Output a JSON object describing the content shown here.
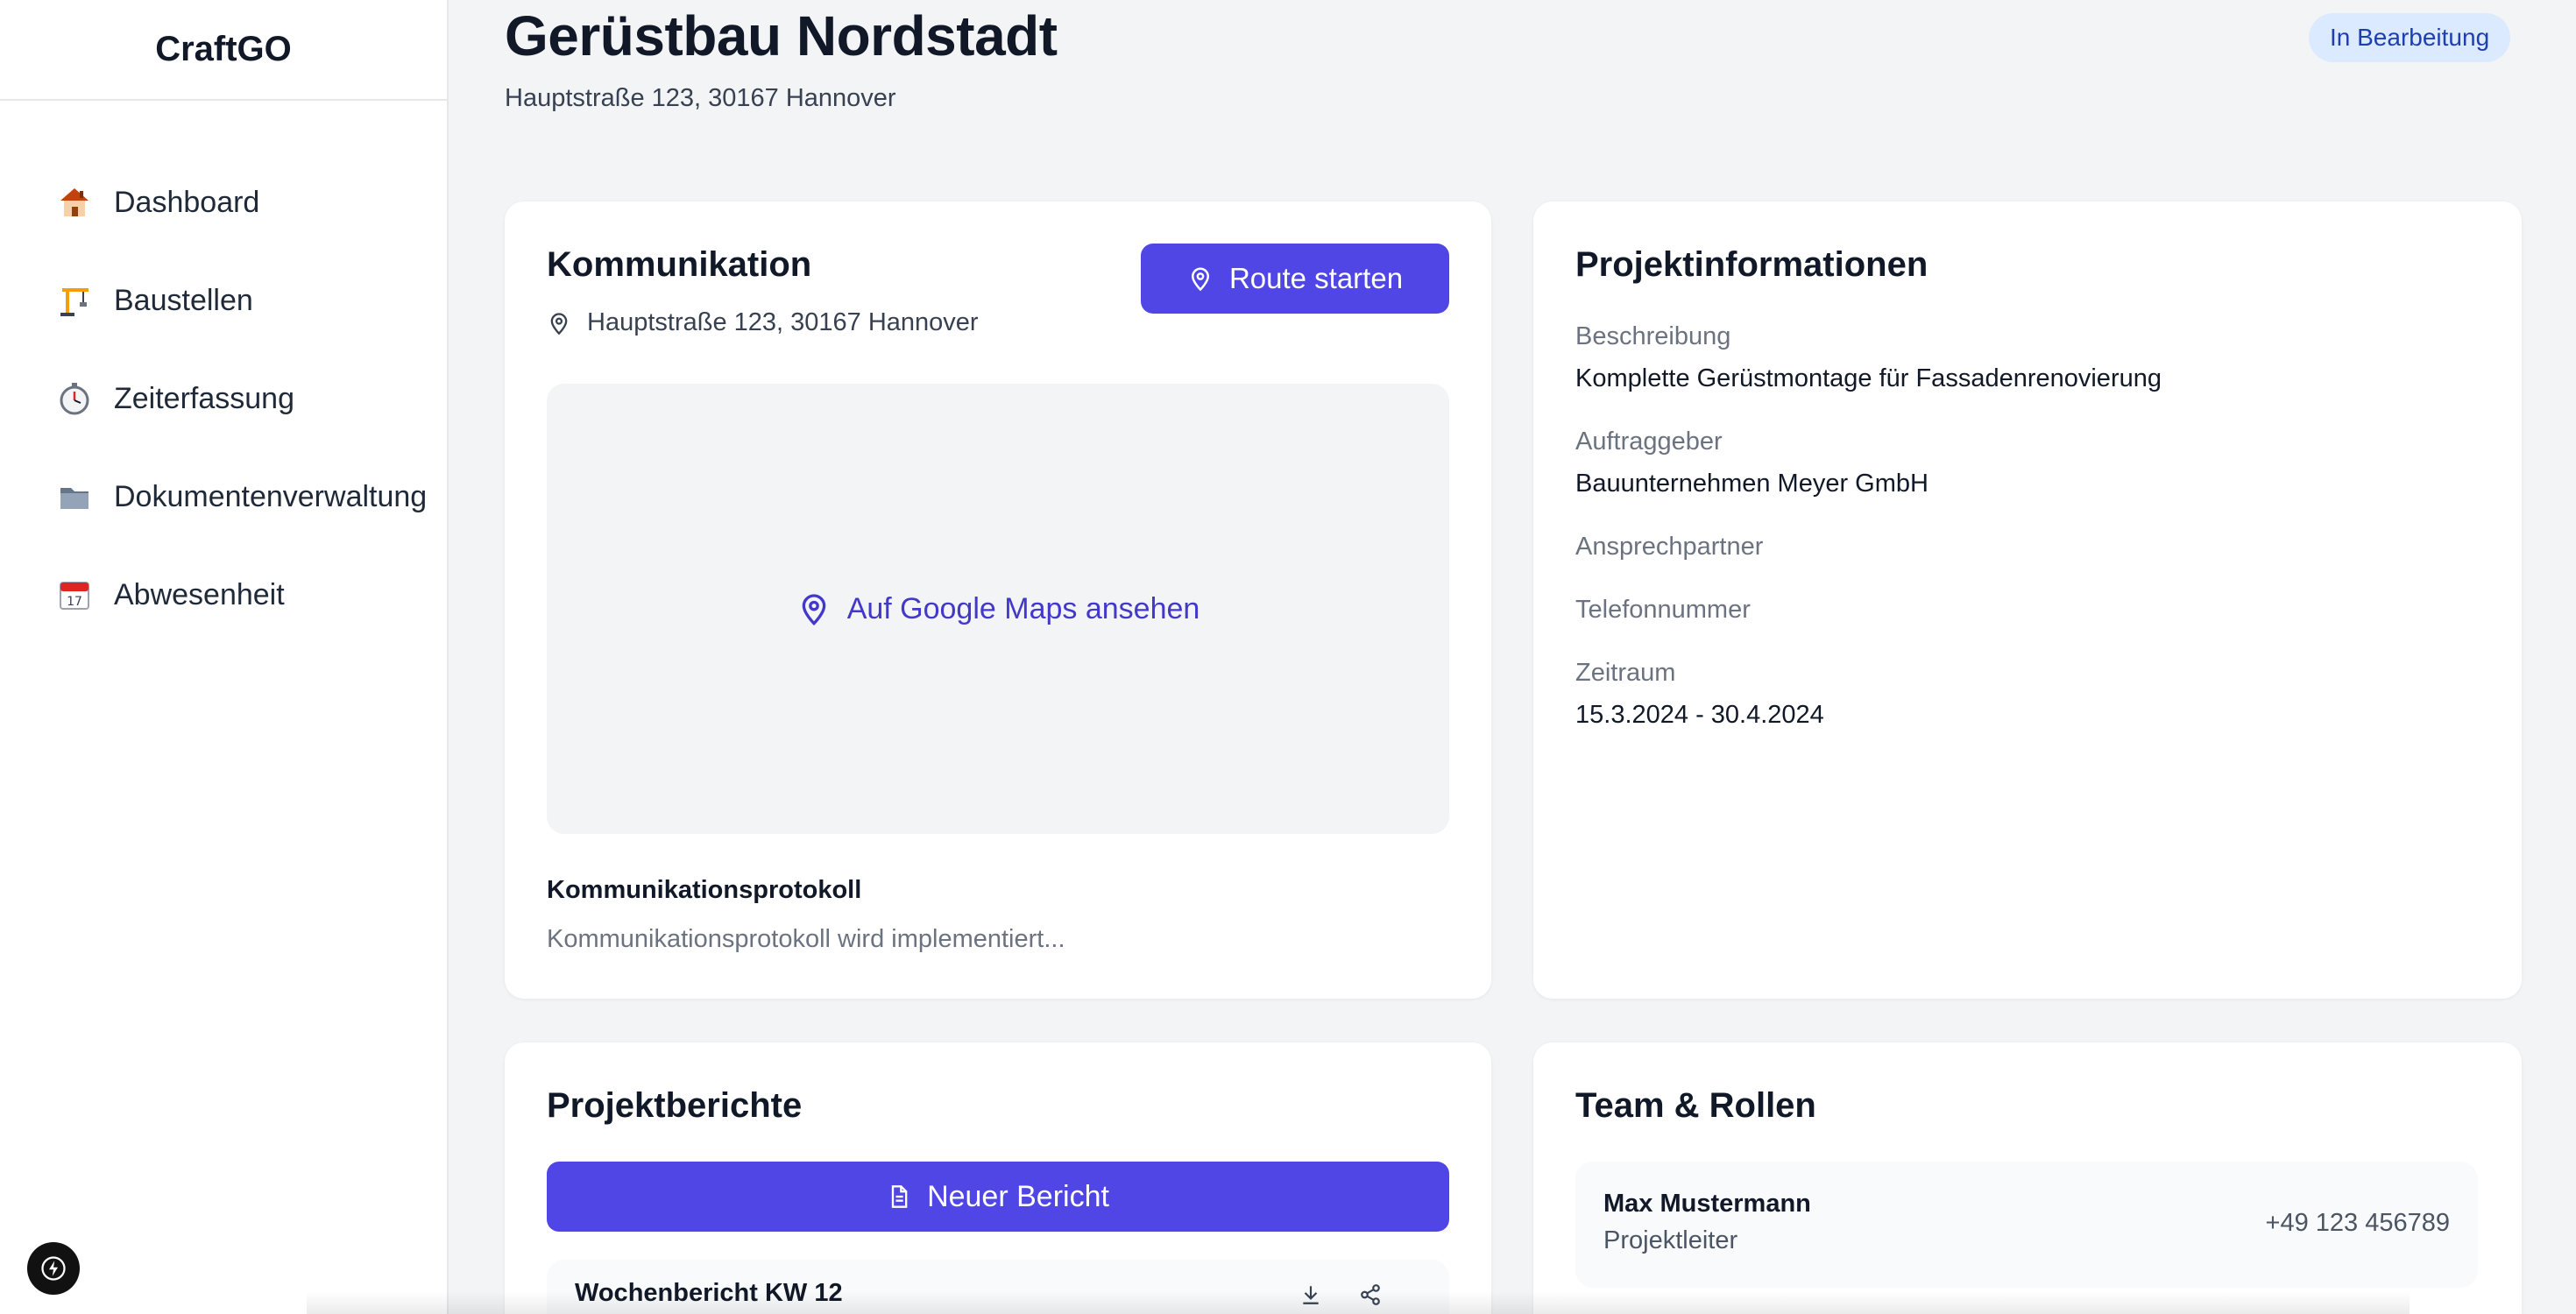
{
  "sidebar": {
    "brand": "CraftGO",
    "items": [
      {
        "label": "Dashboard",
        "icon": "house-icon"
      },
      {
        "label": "Baustellen",
        "icon": "crane-icon"
      },
      {
        "label": "Zeiterfassung",
        "icon": "stopwatch-icon"
      },
      {
        "label": "Dokumentenverwaltung",
        "icon": "folder-icon"
      },
      {
        "label": "Abwesenheit",
        "icon": "calendar-icon"
      }
    ]
  },
  "header": {
    "title": "Gerüstbau Nordstadt",
    "address": "Hauptstraße 123, 30167 Hannover",
    "status": "In Bearbeitung"
  },
  "kommunikation": {
    "title": "Kommunikation",
    "address": "Hauptstraße 123, 30167 Hannover",
    "route_button": "Route starten",
    "map_link": "Auf Google Maps ansehen",
    "protocol_title": "Kommunikationsprotokoll",
    "protocol_text": "Kommunikationsprotokoll wird implementiert..."
  },
  "projektinfo": {
    "title": "Projektinformationen",
    "fields": [
      {
        "label": "Beschreibung",
        "value": "Komplette Gerüstmontage für Fassadenrenovierung"
      },
      {
        "label": "Auftraggeber",
        "value": "Bauunternehmen Meyer GmbH"
      },
      {
        "label": "Ansprechpartner",
        "value": ""
      },
      {
        "label": "Telefonnummer",
        "value": ""
      },
      {
        "label": "Zeitraum",
        "value": "15.3.2024 - 30.4.2024"
      }
    ]
  },
  "berichte": {
    "title": "Projektberichte",
    "new_button": "Neuer Bericht",
    "items": [
      {
        "title": "Wochenbericht KW 12"
      }
    ]
  },
  "team": {
    "title": "Team & Rollen",
    "members": [
      {
        "name": "Max Mustermann",
        "role": "Projektleiter",
        "phone": "+49 123 456789"
      }
    ]
  },
  "colors": {
    "accent": "#4f46e5",
    "link": "#4338ca",
    "badge_bg": "#dbeafe",
    "badge_text": "#1e40af",
    "page_bg": "#f3f4f6"
  }
}
